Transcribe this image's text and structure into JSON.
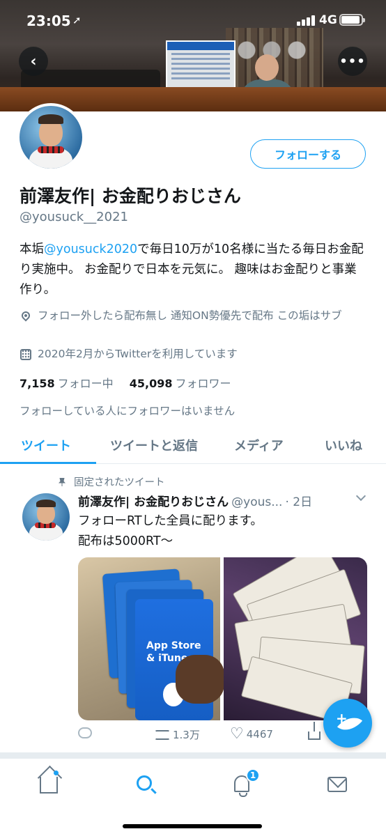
{
  "status_bar": {
    "time": "23:05",
    "network": "4G"
  },
  "profile": {
    "display_name": "前澤友作| お金配りおじさん",
    "handle": "@yousuck__2021",
    "follow_label": "フォローする",
    "bio_prefix": "本垢",
    "bio_mention": "@yousuck2020",
    "bio_rest": "で毎日10万が10名様に当たる毎日お金配り実施中。 お金配りで日本を元気に。 趣味はお金配りと事業作り。",
    "location": "フォロー外したら配布無し 通知ON勢優先で配布 この垢はサブ",
    "joined": "2020年2月からTwitterを利用しています",
    "following_count": "7,158",
    "following_label": "フォロー中",
    "followers_count": "45,098",
    "followers_label": "フォロワー",
    "followers_note": "フォローしている人にフォロワーはいません"
  },
  "tabs": [
    {
      "label": "ツイート",
      "active": true
    },
    {
      "label": "ツイートと返信",
      "active": false
    },
    {
      "label": "メディア",
      "active": false
    },
    {
      "label": "いいね",
      "active": false
    }
  ],
  "tweet": {
    "pinned_label": "固定されたツイート",
    "author_name": "前澤友作| お金配りおじさん",
    "author_handle": "@yous...",
    "time": "· 2日",
    "text": "フォローRTした全員に配ります。\n配布は5000RT〜",
    "media_card_text": "App Store\n& iTunes",
    "retweets": "1.3万",
    "likes": "4467"
  },
  "tabbar": {
    "notification_badge": "1"
  },
  "colors": {
    "accent": "#1da1f2",
    "secondary_text": "#657786"
  }
}
